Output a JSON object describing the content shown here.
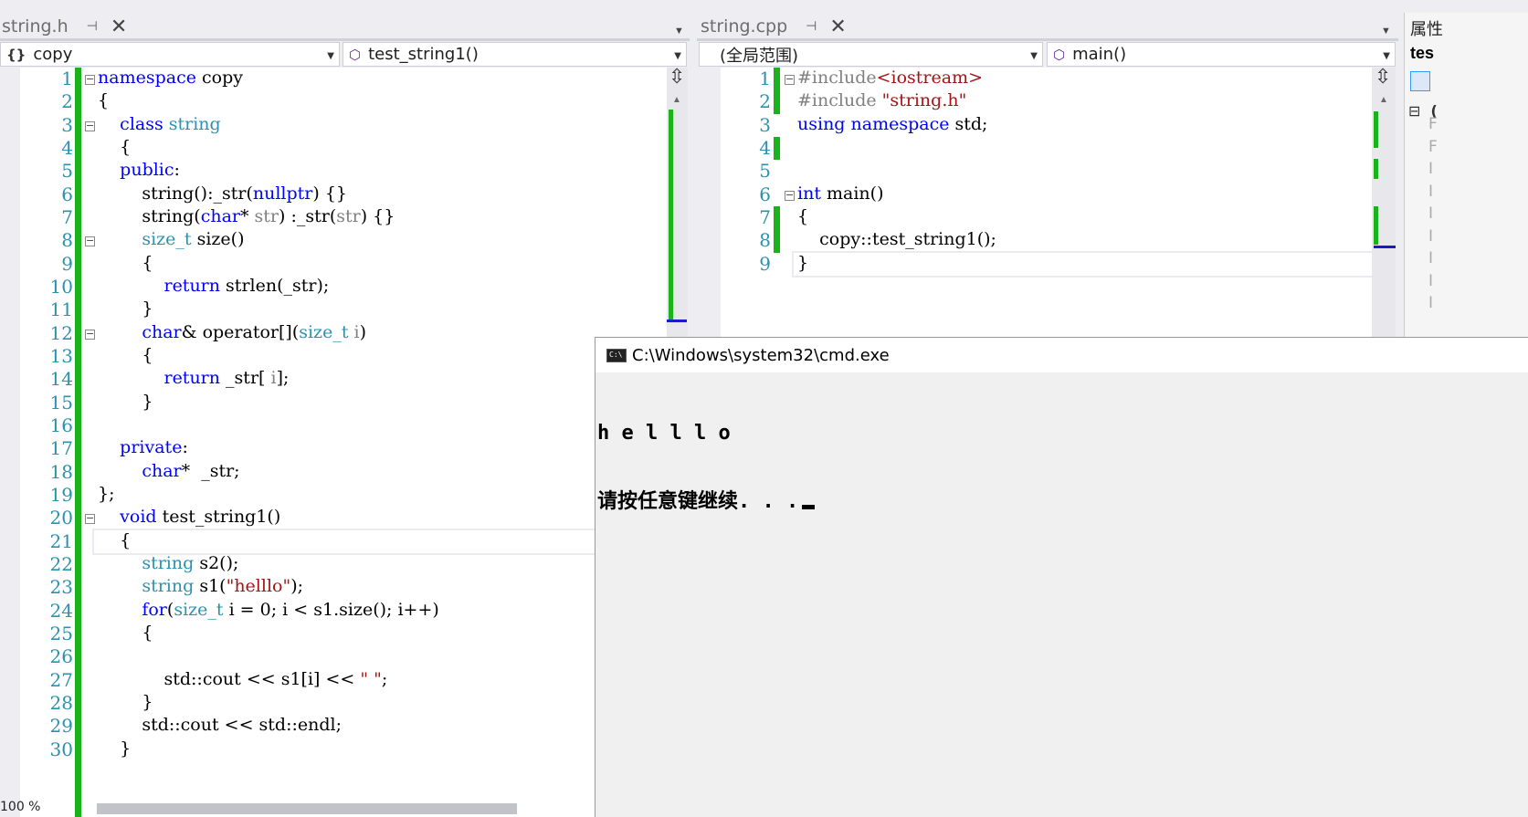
{
  "left_pane": {
    "tab": {
      "name": "string.h",
      "pin": "⊣",
      "close": "✕"
    },
    "nav": {
      "scope": "copy",
      "member": "test_string1()"
    },
    "lines": [
      {
        "n": "1",
        "seg": [
          [
            "kw",
            "namespace"
          ],
          [
            "",
            "copy"
          ]
        ]
      },
      {
        "n": "2",
        "seg": [
          [
            "",
            "{"
          ]
        ]
      },
      {
        "n": "3",
        "seg": [
          [
            "",
            "    "
          ],
          [
            "kw",
            "class"
          ],
          [
            "",
            ""
          ],
          [
            "ty",
            "string"
          ]
        ]
      },
      {
        "n": "4",
        "seg": [
          [
            "",
            "    {"
          ]
        ]
      },
      {
        "n": "5",
        "seg": [
          [
            "",
            "    "
          ],
          [
            "kw",
            "public"
          ],
          [
            "",
            ":"
          ]
        ]
      },
      {
        "n": "6",
        "seg": [
          [
            "",
            "        string():_str("
          ],
          [
            "kw",
            "nullptr"
          ],
          [
            "",
            ") {}"
          ]
        ]
      },
      {
        "n": "7",
        "seg": [
          [
            "",
            "        string("
          ],
          [
            "kw",
            "char"
          ],
          [
            "",
            "*"
          ],
          [
            "pm",
            "str"
          ],
          [
            "",
            ") :_str("
          ],
          [
            "pm",
            "str"
          ],
          [
            "",
            ") {}"
          ]
        ]
      },
      {
        "n": "8",
        "seg": [
          [
            "",
            "        "
          ],
          [
            "ty",
            "size_t"
          ],
          [
            "",
            "size()"
          ]
        ]
      },
      {
        "n": "9",
        "seg": [
          [
            "",
            "        {"
          ]
        ]
      },
      {
        "n": "10",
        "seg": [
          [
            "",
            "            "
          ],
          [
            "kw",
            "return"
          ],
          [
            "",
            "strlen(_str);"
          ]
        ]
      },
      {
        "n": "11",
        "seg": [
          [
            "",
            "        }"
          ]
        ]
      },
      {
        "n": "12",
        "seg": [
          [
            "",
            "        "
          ],
          [
            "kw",
            "char"
          ],
          [
            "",
            "& operator[]("
          ],
          [
            "ty",
            "size_t"
          ],
          [
            "",
            ""
          ],
          [
            "pm",
            "i"
          ],
          [
            "",
            ")"
          ]
        ]
      },
      {
        "n": "13",
        "seg": [
          [
            "",
            "        {"
          ]
        ]
      },
      {
        "n": "14",
        "seg": [
          [
            "",
            "            "
          ],
          [
            "kw",
            "return"
          ],
          [
            "",
            "_str["
          ],
          [
            "pm",
            "i"
          ],
          [
            "",
            "];"
          ]
        ]
      },
      {
        "n": "15",
        "seg": [
          [
            "",
            "        }"
          ]
        ]
      },
      {
        "n": "16",
        "seg": [
          [
            "",
            ""
          ]
        ]
      },
      {
        "n": "17",
        "seg": [
          [
            "",
            "    "
          ],
          [
            "kw",
            "private"
          ],
          [
            "",
            ":"
          ]
        ]
      },
      {
        "n": "18",
        "seg": [
          [
            "",
            "        "
          ],
          [
            "kw",
            "char"
          ],
          [
            "",
            "*  _str;"
          ]
        ]
      },
      {
        "n": "19",
        "seg": [
          [
            "",
            "};"
          ]
        ]
      },
      {
        "n": "20",
        "seg": [
          [
            "",
            "    "
          ],
          [
            "kw",
            "void"
          ],
          [
            "",
            "test_string1()"
          ]
        ]
      },
      {
        "n": "21",
        "seg": [
          [
            "",
            "    {"
          ]
        ]
      },
      {
        "n": "22",
        "seg": [
          [
            "",
            "        "
          ],
          [
            "ty",
            "string"
          ],
          [
            "",
            "s2();"
          ]
        ]
      },
      {
        "n": "23",
        "seg": [
          [
            "",
            "        "
          ],
          [
            "ty",
            "string"
          ],
          [
            "",
            "s1("
          ],
          [
            "st",
            "\"helllo\""
          ],
          [
            "",
            ");"
          ]
        ]
      },
      {
        "n": "24",
        "seg": [
          [
            "",
            "        "
          ],
          [
            "kw",
            "for"
          ],
          [
            "",
            "("
          ],
          [
            "ty",
            "size_t"
          ],
          [
            "",
            "i = 0; i < s1.size(); i++)"
          ]
        ]
      },
      {
        "n": "25",
        "seg": [
          [
            "",
            "        {"
          ]
        ]
      },
      {
        "n": "26",
        "seg": [
          [
            "",
            ""
          ]
        ]
      },
      {
        "n": "27",
        "seg": [
          [
            "",
            "            std::cout << s1[i] << "
          ],
          [
            "st",
            "\" \""
          ],
          [
            "",
            ";"
          ]
        ]
      },
      {
        "n": "28",
        "seg": [
          [
            "",
            "        }"
          ]
        ]
      },
      {
        "n": "29",
        "seg": [
          [
            "",
            "        std::cout << std::endl;"
          ]
        ]
      },
      {
        "n": "30",
        "seg": [
          [
            "",
            "    }"
          ]
        ]
      }
    ]
  },
  "right_pane": {
    "tab": {
      "name": "string.cpp",
      "pin": "⊣",
      "close": "✕"
    },
    "nav": {
      "scope": "(全局范围)",
      "member": "main()"
    },
    "lines": [
      {
        "n": "1",
        "seg": [
          [
            "pp",
            "#include"
          ],
          [
            "st",
            "<iostream>"
          ]
        ]
      },
      {
        "n": "2",
        "seg": [
          [
            "pp",
            "#include"
          ],
          [
            "st",
            "\"string.h\""
          ]
        ]
      },
      {
        "n": "3",
        "seg": [
          [
            "kw",
            "using"
          ],
          [
            "",
            ""
          ],
          [
            "kw",
            "namespace"
          ],
          [
            "",
            "std;"
          ]
        ]
      },
      {
        "n": "4",
        "seg": [
          [
            "",
            ""
          ]
        ]
      },
      {
        "n": "5",
        "seg": [
          [
            "",
            ""
          ]
        ]
      },
      {
        "n": "6",
        "seg": [
          [
            "kw",
            "int"
          ],
          [
            "",
            "main()"
          ]
        ]
      },
      {
        "n": "7",
        "seg": [
          [
            "",
            "{"
          ]
        ]
      },
      {
        "n": "8",
        "seg": [
          [
            "",
            "    copy::test_string1();"
          ]
        ]
      },
      {
        "n": "9",
        "seg": [
          [
            "",
            "}"
          ]
        ]
      }
    ]
  },
  "console": {
    "title": "C:\\Windows\\system32\\cmd.exe",
    "output_line1": "h e l l l o",
    "output_line2": "请按任意键继续. . ."
  },
  "properties": {
    "title": "属性",
    "subtitle": "tes",
    "tree_toggle": "⊟",
    "tree_item": "(",
    "letters": [
      "F",
      "F",
      "I",
      "I",
      "I",
      "I",
      "I",
      "I",
      "I"
    ]
  },
  "status": {
    "zoom": "100 %"
  },
  "icons": {
    "scope_icon": "brace-icon",
    "member_icon": "method-cube-icon",
    "split_icon": "split-editor-icon"
  }
}
